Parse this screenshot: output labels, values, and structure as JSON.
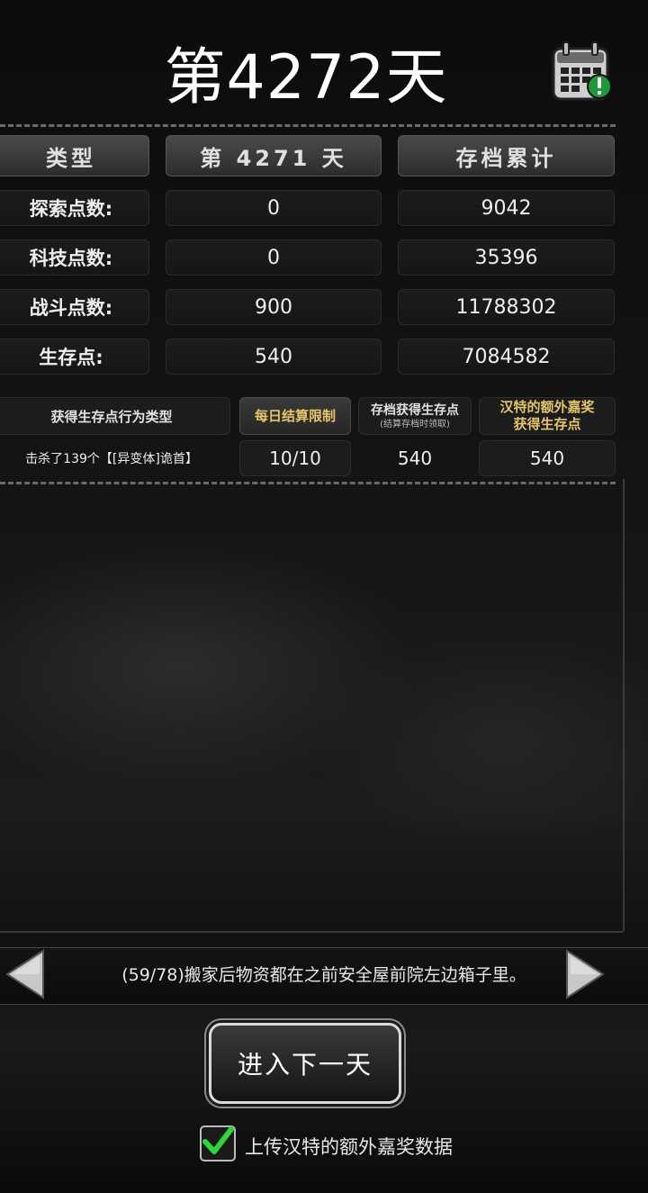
{
  "header": {
    "title": "第4272天",
    "calendar_icon": "calendar-alert-icon"
  },
  "summary_table": {
    "headers": [
      "类型",
      "第 4271 天",
      "存档累计"
    ],
    "rows": [
      {
        "label": "探索点数:",
        "day": "0",
        "total": "9042"
      },
      {
        "label": "科技点数:",
        "day": "0",
        "total": "35396"
      },
      {
        "label": "战斗点数:",
        "day": "900",
        "total": "11788302"
      },
      {
        "label": "生存点:",
        "day": "540",
        "total": "7084582"
      }
    ]
  },
  "action_table": {
    "header_type": "获得生存点行为类型",
    "header_limit": "每日结算限制",
    "header_save": "存档获得生存点",
    "header_save_note": "(结算存档时领取)",
    "header_bonus_line1": "汉特的额外嘉奖",
    "header_bonus_line2": "获得生存点",
    "row": {
      "type": "击杀了139个【[异变体]诡首】",
      "limit": "10/10",
      "save": "540",
      "bonus": "540"
    }
  },
  "notice": {
    "text": "(59/78)搬家后物资都在之前安全屋前院左边箱子里。"
  },
  "next_button": {
    "label": "进入下一天"
  },
  "upload_checkbox": {
    "label": "上传汉特的额外嘉奖数据",
    "checked": true
  },
  "colors": {
    "gold": "#e6c46a",
    "check_green": "#2fd63a",
    "badge_green": "#1f9a3a"
  }
}
